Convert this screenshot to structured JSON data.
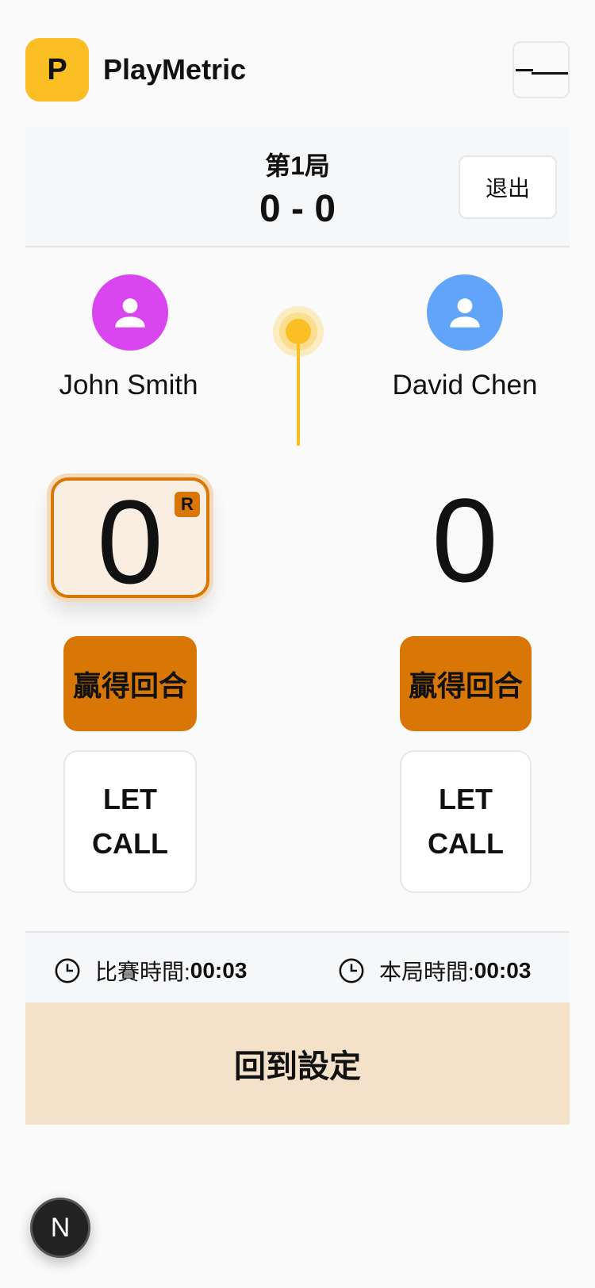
{
  "header": {
    "logo_letter": "P",
    "app_name": "PlayMetric"
  },
  "game": {
    "title": "第1局",
    "score": "0 - 0",
    "exit_label": "退出"
  },
  "players": [
    {
      "name": "John Smith",
      "avatar_color": "#d946ef",
      "score": "0",
      "serve_badge": "R",
      "serving": true
    },
    {
      "name": "David Chen",
      "avatar_color": "#60a5fa",
      "score": "0",
      "serving": false
    }
  ],
  "actions": {
    "win_rally_label": "贏得回合",
    "let_call_line1": "LET",
    "let_call_line2": "CALL"
  },
  "timers": {
    "match_label": "比賽時間:",
    "match_value": "00:03",
    "game_label": "本局時間:",
    "game_value": "00:03"
  },
  "footer": {
    "back_label": "回到設定",
    "n_badge": "N"
  },
  "colors": {
    "accent": "#fbbf24",
    "win_button": "#d97706",
    "back_bg": "#f3e2c9"
  }
}
